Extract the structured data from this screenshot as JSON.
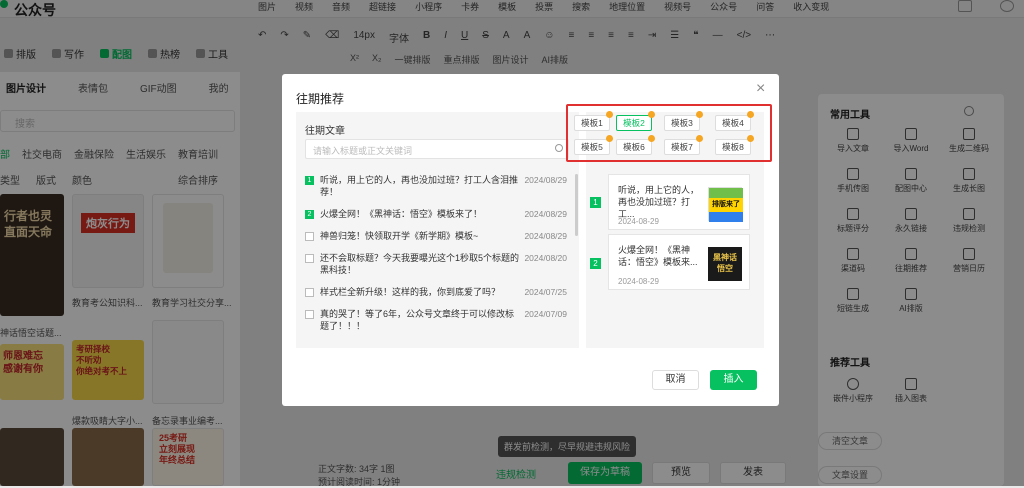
{
  "brand": "公众号",
  "topnav": [
    "图片",
    "视频",
    "音频",
    "超链接",
    "小程序",
    "卡券",
    "模板",
    "投票",
    "搜索",
    "地理位置",
    "视频号",
    "公众号",
    "问答",
    "收入变现"
  ],
  "second_tabs": [
    "排版",
    "写作",
    "配图",
    "热榜",
    "工具"
  ],
  "toolbar": {
    "font_size": "14px",
    "font": "字体",
    "one_click": "一键排版",
    "layout": "重点排版",
    "img_design": "图片设计",
    "ai": "AI排版"
  },
  "left_panel": {
    "tabs": [
      "图片设计",
      "表情包",
      "GIF动图",
      "我的"
    ],
    "search_placeholder": "搜索",
    "categories": [
      "部",
      "社交电商",
      "金融保险",
      "生活娱乐",
      "教育培训"
    ],
    "filters": [
      "类型",
      "版式",
      "颜色"
    ],
    "sort": "综合排序",
    "cards": [
      {
        "caption": "",
        "badge": "图片"
      },
      {
        "caption": "教育考公知识科...",
        "badge": "图片"
      },
      {
        "caption": "教育学习社交分享...",
        "badge": "图片"
      },
      {
        "caption": "神话悟空话题...",
        "badge": "图片"
      },
      {
        "caption": "爆款吸睛大字小...",
        "badge": "图片"
      },
      {
        "caption": "备忘录事业编考...",
        "badge": "图片"
      }
    ],
    "thumb_texts": [
      "行者也灵\n直面天命",
      "炮灰行为",
      "考研择校\n不听劝\n你绝对考不上",
      "师恩难忘\n感谢有你",
      "25考研\n立刻展现\n年终总结"
    ]
  },
  "right_panel": {
    "common_title": "常用工具",
    "common_tools": [
      "导入文章",
      "导入Word",
      "生成二维码",
      "手机传图",
      "配图中心",
      "生成长图",
      "标题评分",
      "永久链接",
      "违规检测",
      "渠道码",
      "往期推荐",
      "营销日历",
      "短链生成",
      "AI排版"
    ],
    "recommend_title": "推荐工具",
    "recommend_tools": [
      "嵌件小程序",
      "插入图表"
    ],
    "extra": [
      "清空文章",
      "文章设置"
    ]
  },
  "bottom": {
    "word_count": "正文字数: 34字 1图",
    "read_time": "预计阅读时间: 1分钟",
    "check": "违规检测",
    "save": "保存为草稿",
    "preview": "预览",
    "publish": "发表",
    "tooltip": "群发前检测，尽早规避违规风险"
  },
  "modal": {
    "title": "往期推荐",
    "close": "×",
    "list_title": "往期文章",
    "search_placeholder": "请输入标题或正文关键词",
    "articles": [
      {
        "num": "1",
        "title": "听说，用上它的人，再也没加过班？打工人含泪推荐！",
        "date": "2024/08/29",
        "checked": true
      },
      {
        "num": "2",
        "title": "火爆全网！《黑神话：悟空》模板来了！",
        "date": "2024/08/29",
        "checked": true
      },
      {
        "num": "",
        "title": "神兽归笼！快领取开学《新学期》模板~",
        "date": "2024/08/29",
        "checked": false
      },
      {
        "num": "",
        "title": "还不会取标题？今天我要曝光这个1秒取5个标题的黑科技！",
        "date": "2024/08/20",
        "checked": false
      },
      {
        "num": "",
        "title": "样式栏全新升级！这样的我，你到底爱了吗？",
        "date": "2024/07/25",
        "checked": false
      },
      {
        "num": "",
        "title": "真的哭了！等了6年，公众号文章终于可以修改标题了！！！",
        "date": "2024/07/09",
        "checked": false
      }
    ],
    "templates": [
      "模板1",
      "模板2",
      "模板3",
      "模板4",
      "模板5",
      "模板6",
      "模板7",
      "模板8"
    ],
    "active_template": "模板2",
    "selected": [
      {
        "num": "1",
        "title": "听说，用上它的人，再也没加过班？打工...",
        "date": "2024-08-29",
        "img_text": "排版来了"
      },
      {
        "num": "2",
        "title": "火爆全网！《黑神话：悟空》模板来...",
        "date": "2024-08-29",
        "img_text": "黑神话\n悟空"
      }
    ],
    "cancel": "取消",
    "insert": "插入"
  },
  "colors": {
    "accent": "#07c160",
    "highlight": "#e03030",
    "badge": "#f5a623"
  }
}
